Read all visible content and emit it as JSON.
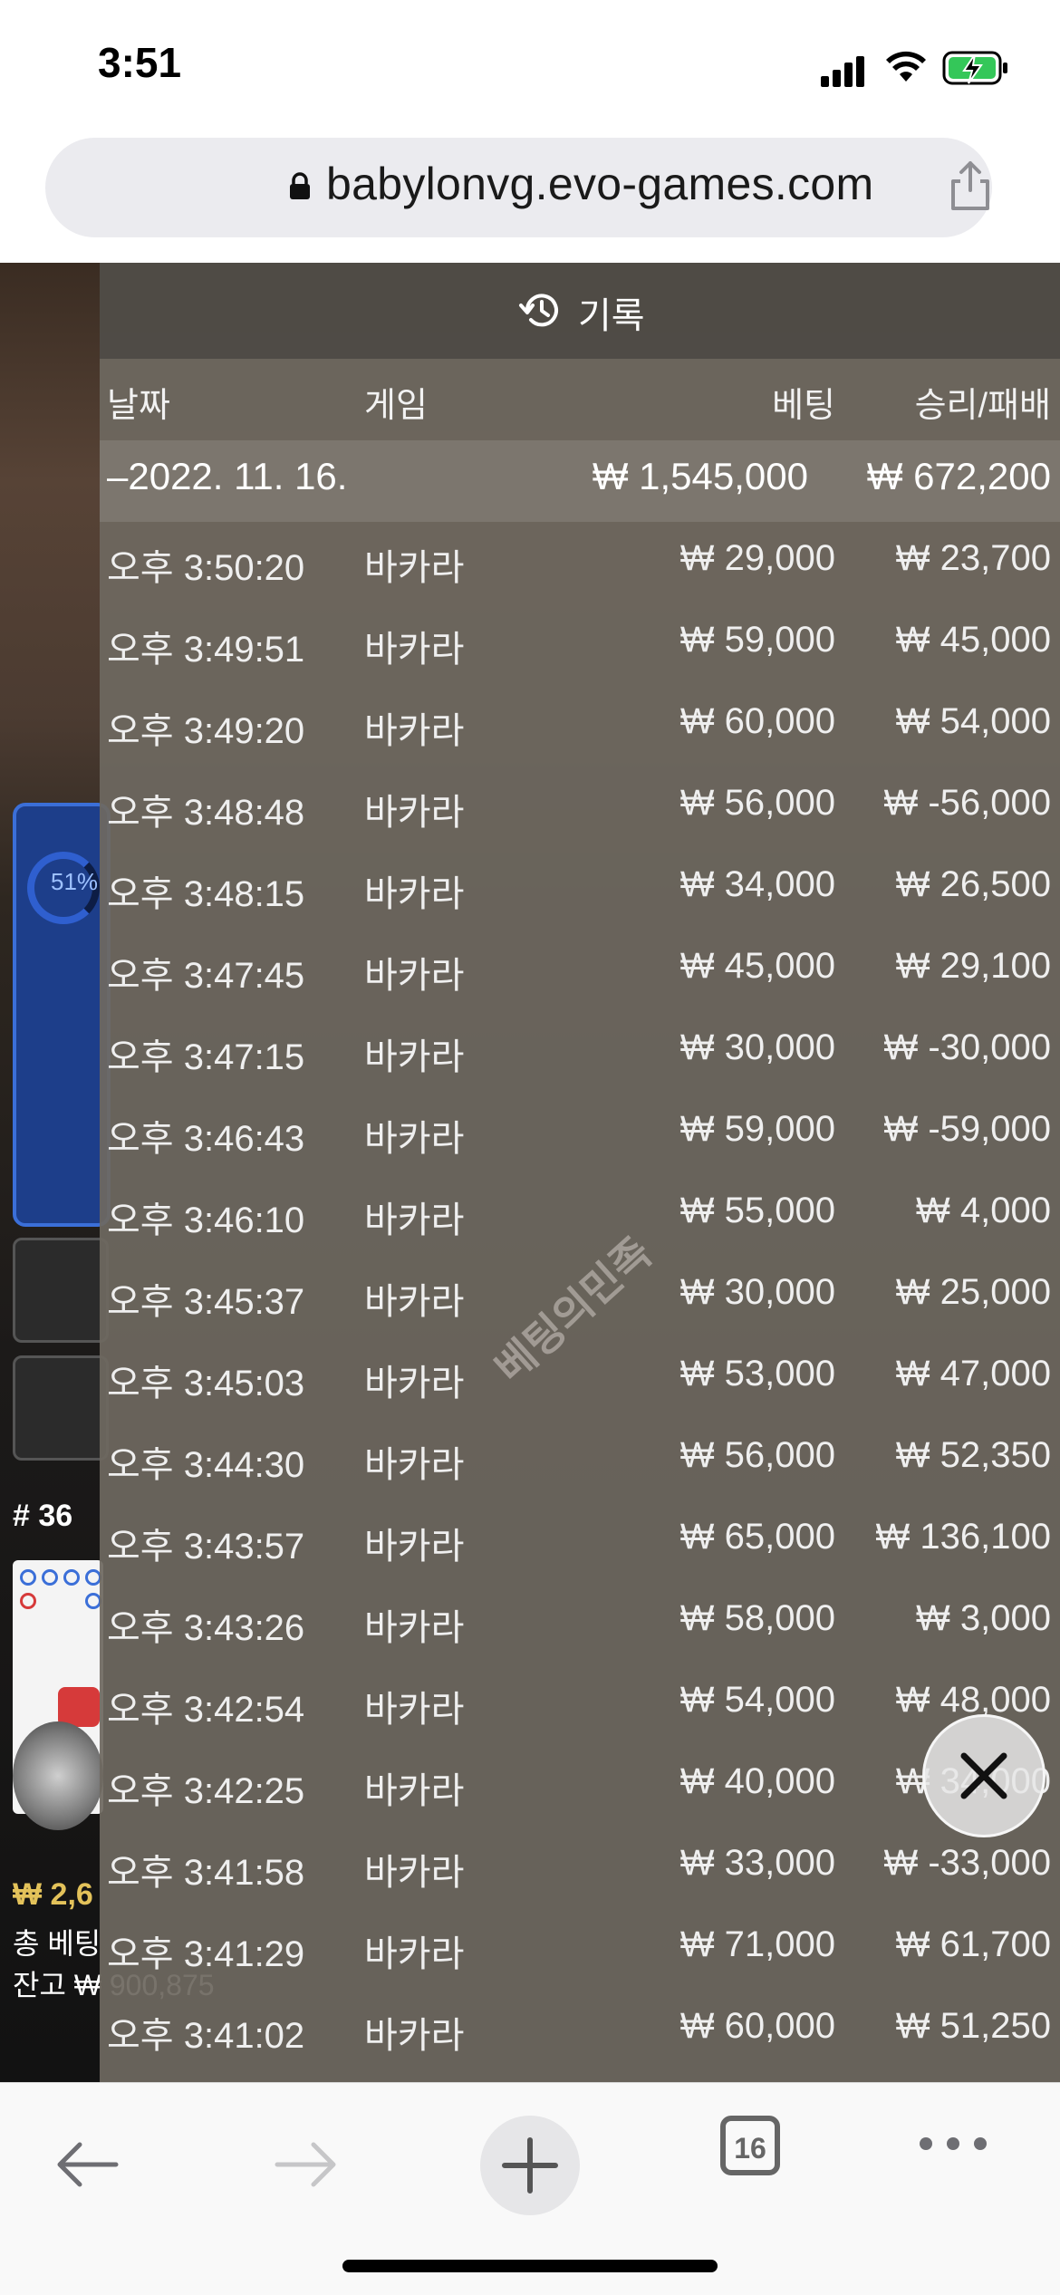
{
  "status_bar": {
    "time": "3:51"
  },
  "browser": {
    "url": "babylonvg.evo-games.com"
  },
  "background": {
    "percent": "51%",
    "round": "# 36",
    "balance_amount": "₩ 2,6",
    "total_bet_label": "총 베팅",
    "balance_label": "잔고 ₩ 900,875"
  },
  "history_panel": {
    "title": "기록",
    "columns": {
      "date": "날짜",
      "game": "게임",
      "bet": "베팅",
      "win_loss": "승리/패배"
    },
    "summary": {
      "date": "–2022. 11. 16.",
      "bet": "₩ 1,545,000",
      "win_loss": "₩ 672,200"
    },
    "rows": [
      {
        "time": "오후 3:50:20",
        "game": "바카라",
        "bet": "₩ 29,000",
        "win_loss": "₩ 23,700"
      },
      {
        "time": "오후 3:49:51",
        "game": "바카라",
        "bet": "₩ 59,000",
        "win_loss": "₩ 45,000"
      },
      {
        "time": "오후 3:49:20",
        "game": "바카라",
        "bet": "₩ 60,000",
        "win_loss": "₩ 54,000"
      },
      {
        "time": "오후 3:48:48",
        "game": "바카라",
        "bet": "₩ 56,000",
        "win_loss": "₩ -56,000"
      },
      {
        "time": "오후 3:48:15",
        "game": "바카라",
        "bet": "₩ 34,000",
        "win_loss": "₩ 26,500"
      },
      {
        "time": "오후 3:47:45",
        "game": "바카라",
        "bet": "₩ 45,000",
        "win_loss": "₩ 29,100"
      },
      {
        "time": "오후 3:47:15",
        "game": "바카라",
        "bet": "₩ 30,000",
        "win_loss": "₩ -30,000"
      },
      {
        "time": "오후 3:46:43",
        "game": "바카라",
        "bet": "₩ 59,000",
        "win_loss": "₩ -59,000"
      },
      {
        "time": "오후 3:46:10",
        "game": "바카라",
        "bet": "₩ 55,000",
        "win_loss": "₩ 4,000"
      },
      {
        "time": "오후 3:45:37",
        "game": "바카라",
        "bet": "₩ 30,000",
        "win_loss": "₩ 25,000"
      },
      {
        "time": "오후 3:45:03",
        "game": "바카라",
        "bet": "₩ 53,000",
        "win_loss": "₩ 47,000"
      },
      {
        "time": "오후 3:44:30",
        "game": "바카라",
        "bet": "₩ 56,000",
        "win_loss": "₩ 52,350"
      },
      {
        "time": "오후 3:43:57",
        "game": "바카라",
        "bet": "₩ 65,000",
        "win_loss": "₩ 136,100"
      },
      {
        "time": "오후 3:43:26",
        "game": "바카라",
        "bet": "₩ 58,000",
        "win_loss": "₩ 3,000"
      },
      {
        "time": "오후 3:42:54",
        "game": "바카라",
        "bet": "₩ 54,000",
        "win_loss": "₩ 48,000"
      },
      {
        "time": "오후 3:42:25",
        "game": "바카라",
        "bet": "₩ 40,000",
        "win_loss": "₩ 34,000"
      },
      {
        "time": "오후 3:41:58",
        "game": "바카라",
        "bet": "₩ 33,000",
        "win_loss": "₩ -33,000"
      },
      {
        "time": "오후 3:41:29",
        "game": "바카라",
        "bet": "₩ 71,000",
        "win_loss": "₩ 61,700"
      },
      {
        "time": "오후 3:41:02",
        "game": "바카라",
        "bet": "₩ 60,000",
        "win_loss": "₩ 51,250"
      }
    ],
    "watermark": "베팅의민족"
  },
  "toolbar": {
    "tab_count": "16"
  },
  "icons": {
    "history": "history-icon",
    "close": "close-icon",
    "back": "back-arrow-icon",
    "forward": "forward-arrow-icon",
    "new_tab": "plus-icon",
    "tabs": "tabs-icon",
    "more": "more-icon",
    "share": "share-icon",
    "lock": "lock-icon"
  }
}
